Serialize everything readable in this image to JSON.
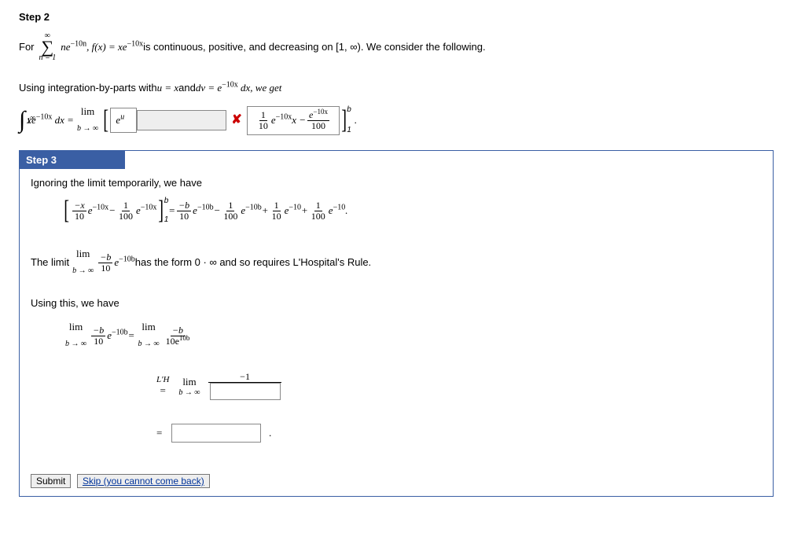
{
  "step2": {
    "title": "Step 2",
    "line1_pre": "For  ",
    "sigma_top": "∞",
    "sigma_bot": "n = 1",
    "series": "ne",
    "series_exp": "−10n",
    "comma": ",   f(x) = xe",
    "fx_exp": "−10x",
    "line1_post": "  is continuous, positive, and decreasing on [1, ∞). We consider the following.",
    "line2_a": "Using integration-by-parts with  ",
    "line2_b": "u = x",
    "line2_c": "  and  ",
    "line2_d": "dv = e",
    "line2_e_exp": "−10x",
    "line2_f": " dx,  we get",
    "int_top": "∞",
    "int_bot": "1",
    "integrand": "xe",
    "integrand_exp": "−10x",
    "dx": " dx  = ",
    "lim": "lim",
    "lim_under": "b → ∞",
    "input_val": "e",
    "input_sup": "u",
    "box2_f1_num": "1",
    "box2_f1_den": "10",
    "box2_e1": "e",
    "box2_e1_exp": "−10x",
    "box2_x": "x  −  ",
    "box2_f2_num": "e",
    "box2_f2_num_exp": "−10x",
    "box2_f2_den": "100",
    "bkt_top": "b",
    "bkt_bot": "1",
    "dot": "."
  },
  "step3": {
    "title": "Step 3",
    "line1": "Ignoring the limit temporarily, we have",
    "lhs_t1_num": "−x",
    "lhs_t1_den": "10",
    "e": "e",
    "exp_m10x": "−10x",
    "minus": "  −  ",
    "lhs_t2_num": "1",
    "lhs_t2_den": "100",
    "bkt_top": "b",
    "bkt_bot": "1",
    "eq": "  =  ",
    "rhs_t1_num": "−b",
    "rhs_t1_den": "10",
    "exp_m10b": "−10b",
    "rhs_t2_num": "1",
    "rhs_t2_den": "100",
    "plus": "  +  ",
    "rhs_t3_num": "1",
    "rhs_t3_den": "10",
    "exp_m10": "−10",
    "rhs_t4_num": "1",
    "rhs_t4_den": "100",
    "dot": ".",
    "line2_a": "The limit   ",
    "lim": "lim",
    "lim_under": "b → ∞",
    "line2_frac_num": "−b",
    "line2_frac_den": "10",
    "line2_b": "  has the form 0 · ∞ and so requires L'Hospital's Rule.",
    "line3": "Using this, we have",
    "eq4_left_num": "−b",
    "eq4_left_den": "10",
    "eq4_eq": "   =   ",
    "eq4_right_num": "−b",
    "eq4_right_den_a": "10e",
    "eq4_right_den_exp": "10b",
    "lh_label_top": "L'H",
    "lh_label_bot": "=",
    "lh_num": "−1",
    "final_eq": "=",
    "final_dot": ".",
    "submit": "Submit",
    "skip": "Skip (you cannot come back)"
  }
}
